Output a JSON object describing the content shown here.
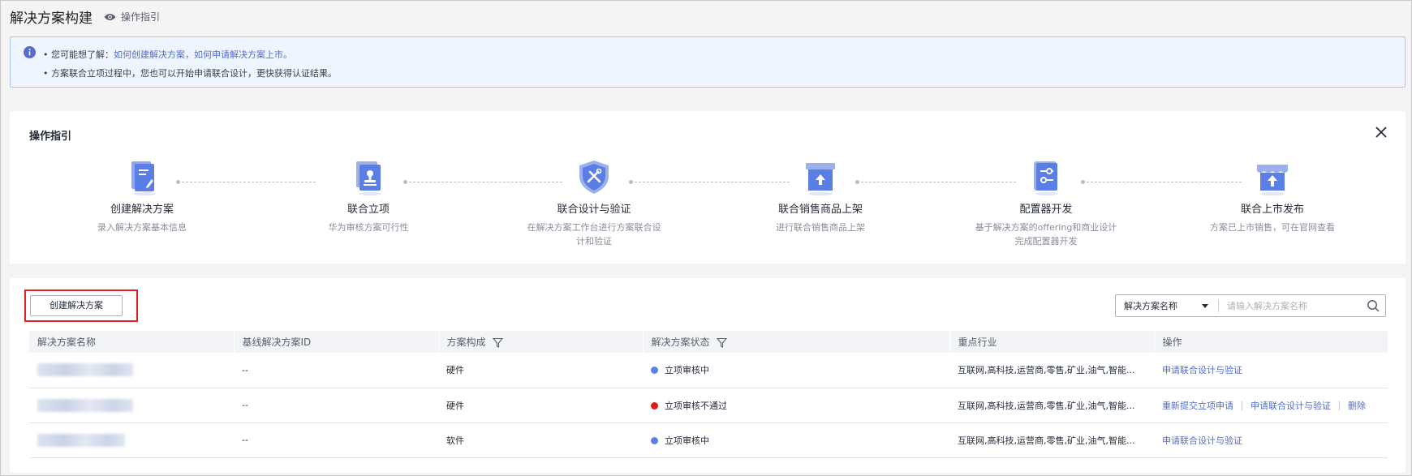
{
  "header": {
    "title": "解决方案构建",
    "guide_link": "操作指引"
  },
  "info": {
    "line1_prefix": "• 您可能想了解：",
    "link1": "如何创建解决方案",
    "sep": "，",
    "link2": "如何申请解决方案上市",
    "line1_suffix": "。",
    "line2": "• 方案联合立项过程中，您也可以开始申请联合设计，更快获得认证结果。"
  },
  "guide": {
    "title": "操作指引",
    "steps": [
      {
        "title": "创建解决方案",
        "desc": "录入解决方案基本信息",
        "icon": "document-edit-icon"
      },
      {
        "title": "联合立项",
        "desc": "华为审核方案可行性",
        "icon": "approval-stamp-icon"
      },
      {
        "title": "联合设计与验证",
        "desc": "在解决方案工作台进行方案联合设计和验证",
        "icon": "shield-tools-icon"
      },
      {
        "title": "联合销售商品上架",
        "desc": "进行联合销售商品上架",
        "icon": "box-upload-icon"
      },
      {
        "title": "配置器开发",
        "desc": "基于解决方案的offering和商业设计完成配置器开发",
        "icon": "configurator-icon"
      },
      {
        "title": "联合上市发布",
        "desc": "方案已上市销售，可在官网查看",
        "icon": "store-upload-icon"
      }
    ]
  },
  "toolbar": {
    "create_label": "创建解决方案",
    "search_field": "解决方案名称",
    "search_placeholder": "请输入解决方案名称"
  },
  "table": {
    "columns": [
      "解决方案名称",
      "基线解决方案ID",
      "方案构成",
      "解决方案状态",
      "重点行业",
      "操作"
    ],
    "rows": [
      {
        "baseline_id": "--",
        "composition": "硬件",
        "status": "立项审核中",
        "status_color": "#5b7ee6",
        "industry": "互联网,高科技,运营商,零售,矿业,油气,智能...",
        "actions": [
          "申请联合设计与验证"
        ]
      },
      {
        "baseline_id": "--",
        "composition": "硬件",
        "status": "立项审核不通过",
        "status_color": "#d91c1c",
        "industry": "互联网,高科技,运营商,零售,矿业,油气,智能...",
        "actions": [
          "重新提交立项申请",
          "申请联合设计与验证",
          "删除"
        ]
      },
      {
        "baseline_id": "--",
        "composition": "软件",
        "status": "立项审核中",
        "status_color": "#5b7ee6",
        "industry": "互联网,高科技,运营商,零售,矿业,油气,智能...",
        "actions": [
          "申请联合设计与验证"
        ]
      }
    ]
  },
  "colors": {
    "accent": "#526ecc",
    "highlight_border": "#e02020",
    "info_bg": "#eef5fe"
  }
}
